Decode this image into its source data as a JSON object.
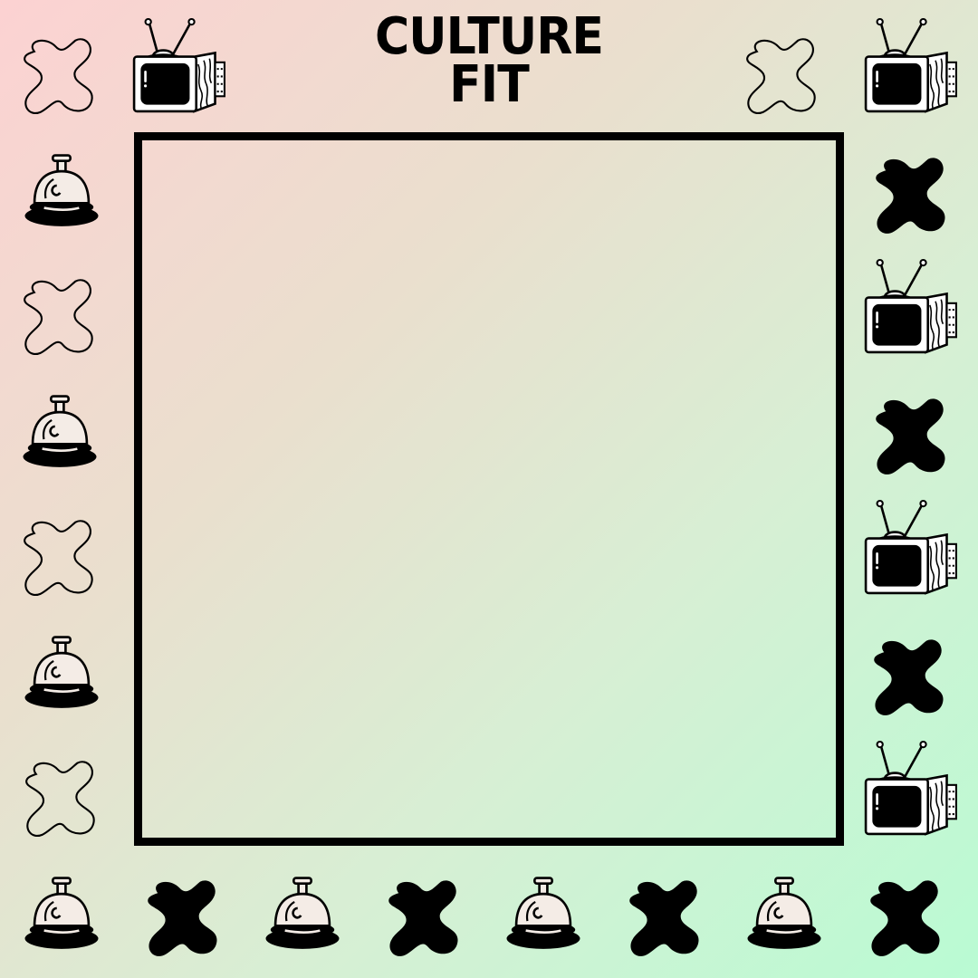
{
  "title": {
    "line1": "CULTURE",
    "line2": "FIT"
  },
  "colors": {
    "gradient_start": "#fcd2d2",
    "gradient_mid": "#eadfce",
    "gradient_end": "#b9fbd3",
    "ink": "#000000"
  },
  "decorations": {
    "left_column": [
      "squiggle-outline-icon",
      "service-bell-icon",
      "squiggle-outline-icon",
      "service-bell-icon",
      "squiggle-outline-icon",
      "service-bell-icon",
      "squiggle-outline-icon"
    ],
    "right_column": [
      "retro-tv-icon",
      "squiggle-filled-icon",
      "retro-tv-icon",
      "squiggle-filled-icon",
      "retro-tv-icon",
      "squiggle-filled-icon",
      "retro-tv-icon"
    ],
    "top_row": [
      "squiggle-outline-icon",
      "retro-tv-icon",
      "squiggle-outline-icon",
      "retro-tv-icon"
    ],
    "bottom_row": [
      "service-bell-icon",
      "squiggle-filled-icon",
      "service-bell-icon",
      "squiggle-filled-icon",
      "service-bell-icon",
      "squiggle-filled-icon",
      "service-bell-icon",
      "squiggle-filled-icon"
    ]
  }
}
